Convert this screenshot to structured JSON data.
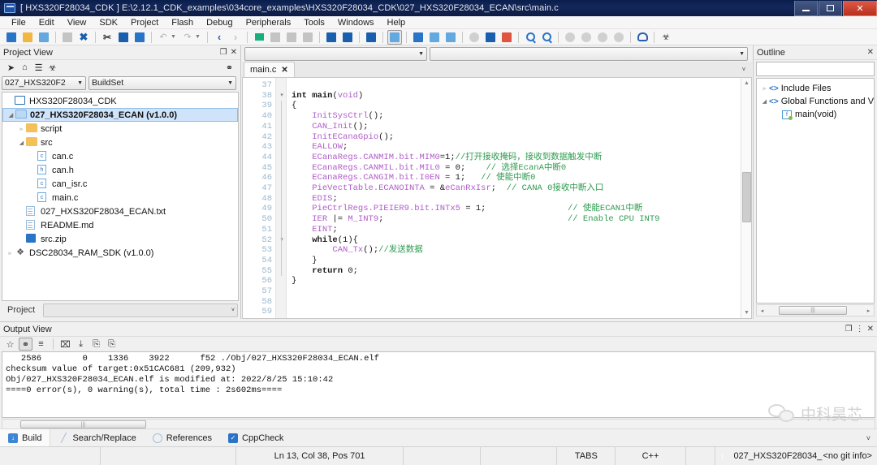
{
  "window": {
    "title": "[ HXS320F28034_CDK ] E:\\2.12.1_CDK_examples\\034core_examples\\HXS320F28034_CDK\\027_HXS320F28034_ECAN\\src\\main.c",
    "minimize_label": "–",
    "maximize_label": "□",
    "close_label": "✕"
  },
  "menu": {
    "items": [
      "File",
      "Edit",
      "View",
      "SDK",
      "Project",
      "Flash",
      "Debug",
      "Peripherals",
      "Tools",
      "Windows",
      "Help"
    ]
  },
  "toolbar": {
    "groups": [
      {
        "buttons": [
          {
            "name": "new-file-button",
            "glyph": "▤",
            "style": "blue"
          },
          {
            "name": "open-folder-button",
            "glyph": "▭",
            "style": "orange"
          },
          {
            "name": "open-file-button",
            "glyph": "◉",
            "style": "lightblue"
          }
        ]
      },
      {
        "buttons": [
          {
            "name": "save-button",
            "glyph": "■",
            "style": "gray"
          },
          {
            "name": "close-file-button",
            "glyph": "✖",
            "style": "x"
          }
        ]
      },
      {
        "buttons": [
          {
            "name": "cut-button",
            "glyph": "✂",
            "style": "scissors"
          },
          {
            "name": "copy-button",
            "glyph": "⧉",
            "style": "bluedk"
          },
          {
            "name": "paste-button",
            "glyph": "⎘",
            "style": "blue"
          }
        ]
      },
      {
        "buttons": [
          {
            "name": "undo-button",
            "glyph": "↶",
            "style": "arrow"
          },
          {
            "name": "undo-dropdown",
            "glyph": "▾",
            "style": "caret"
          },
          {
            "name": "redo-button",
            "glyph": "↷",
            "style": "arrow"
          },
          {
            "name": "redo-dropdown",
            "glyph": "▾",
            "style": "caret"
          }
        ]
      },
      {
        "buttons": [
          {
            "name": "navigate-back-button",
            "glyph": "‹",
            "style": "lt"
          },
          {
            "name": "navigate-forward-button",
            "glyph": "›",
            "style": "gt"
          }
        ]
      },
      {
        "buttons": [
          {
            "name": "build-run-button",
            "glyph": "▰",
            "style": "flag"
          },
          {
            "name": "stop-button",
            "glyph": "■",
            "style": "gray"
          },
          {
            "name": "pause-button",
            "glyph": "■",
            "style": "gray"
          },
          {
            "name": "rebuild-button",
            "glyph": "■",
            "style": "gray"
          }
        ]
      },
      {
        "buttons": [
          {
            "name": "find-button",
            "glyph": "⌕",
            "style": "bluedk"
          },
          {
            "name": "find-replace-button",
            "glyph": "⌕",
            "style": "bluedk"
          }
        ]
      },
      {
        "buttons": [
          {
            "name": "find-in-files-button",
            "glyph": "⌕",
            "style": "bluedk"
          }
        ]
      },
      {
        "buttons": [
          {
            "name": "format-code-button",
            "glyph": "A",
            "style": "boxed"
          }
        ]
      },
      {
        "buttons": [
          {
            "name": "package-button",
            "glyph": "⬢",
            "style": "blue"
          },
          {
            "name": "download-flash-button",
            "glyph": "⬇",
            "style": "lightblue"
          },
          {
            "name": "erase-flash-button",
            "glyph": "⬇",
            "style": "lightblue"
          }
        ]
      },
      {
        "buttons": [
          {
            "name": "debug-circle-button",
            "glyph": "●",
            "style": "circ"
          },
          {
            "name": "device-button",
            "glyph": "□",
            "style": "bluedk"
          },
          {
            "name": "calculator-button",
            "glyph": "▦",
            "style": "red"
          }
        ]
      },
      {
        "buttons": [
          {
            "name": "zoom-in-button",
            "glyph": "⌕",
            "style": "mag"
          },
          {
            "name": "zoom-out-button",
            "glyph": "⌕",
            "style": "mag"
          }
        ]
      },
      {
        "buttons": [
          {
            "name": "breakpoint-button",
            "glyph": "●",
            "style": "circ-dim"
          },
          {
            "name": "link-disabled-button",
            "glyph": "⚭",
            "style": "circ-dim"
          },
          {
            "name": "chain-button",
            "glyph": "⚭",
            "style": "circ-dim"
          },
          {
            "name": "unlink-button",
            "glyph": "⚭",
            "style": "circ-dim"
          }
        ]
      },
      {
        "buttons": [
          {
            "name": "support-headset-button",
            "glyph": "⌂",
            "style": "head"
          }
        ]
      },
      {
        "buttons": [
          {
            "name": "bug-report-button",
            "glyph": "☣",
            "style": "bug"
          }
        ]
      }
    ]
  },
  "project_view": {
    "title": "Project View",
    "float_label": "❐",
    "close_label": "✕",
    "tool_icons": [
      "navigate-icon",
      "home-icon",
      "collapse-icon",
      "bug-icon"
    ],
    "link_icon": "link-icon",
    "combo_project": "027_HXS320F2",
    "combo_buildset": "BuildSet",
    "tree": [
      {
        "label": "HXS320F28034_CDK",
        "indent": 0,
        "icon": "monitor-icon",
        "twisty": "",
        "selected": false
      },
      {
        "label": "027_HXS320F28034_ECAN (v1.0.0)",
        "indent": 0,
        "icon": "folder-blue-icon",
        "twisty": "◢",
        "selected": true
      },
      {
        "label": "script",
        "indent": 1,
        "icon": "folder-icon",
        "twisty": "▹",
        "selected": false
      },
      {
        "label": "src",
        "indent": 1,
        "icon": "folder-icon",
        "twisty": "◢",
        "selected": false
      },
      {
        "label": "can.c",
        "indent": 2,
        "icon": "c-file-icon",
        "twisty": "",
        "selected": false
      },
      {
        "label": "can.h",
        "indent": 2,
        "icon": "h-file-icon",
        "twisty": "",
        "selected": false
      },
      {
        "label": "can_isr.c",
        "indent": 2,
        "icon": "c-file-icon",
        "twisty": "",
        "selected": false
      },
      {
        "label": "main.c",
        "indent": 2,
        "icon": "c-file-icon",
        "twisty": "",
        "selected": false
      },
      {
        "label": "027_HXS320F28034_ECAN.txt",
        "indent": 1,
        "icon": "doc-icon",
        "twisty": "",
        "selected": false
      },
      {
        "label": "README.md",
        "indent": 1,
        "icon": "doc-icon",
        "twisty": "",
        "selected": false
      },
      {
        "label": "src.zip",
        "indent": 1,
        "icon": "zip-icon",
        "twisty": "",
        "selected": false
      },
      {
        "label": "DSC28034_RAM_SDK (v1.0.0)",
        "indent": 0,
        "icon": "sdk-icon",
        "twisty": "▹",
        "selected": false
      }
    ],
    "footer_tab": "Project",
    "footer_caret": "˅"
  },
  "editor": {
    "combo_left": "",
    "combo_right": "",
    "combo_caret": "▾",
    "tab_label": "main.c",
    "tab_close": "✕",
    "tab_list_caret": "˅",
    "first_line_number": 37,
    "lines": [
      {
        "n": 37,
        "segments": []
      },
      {
        "n": 38,
        "segments": [
          {
            "t": "int ",
            "c": "kw"
          },
          {
            "t": "main",
            "c": "kw"
          },
          {
            "t": "(",
            "c": "pl"
          },
          {
            "t": "void",
            "c": "id"
          },
          {
            "t": ")",
            "c": "pl"
          }
        ]
      },
      {
        "n": 39,
        "segments": [
          {
            "t": "{",
            "c": "pl"
          }
        ]
      },
      {
        "n": 40,
        "segments": [
          {
            "t": "    ",
            "c": "pl"
          },
          {
            "t": "InitSysCtrl",
            "c": "id"
          },
          {
            "t": "();",
            "c": "pl"
          }
        ]
      },
      {
        "n": 41,
        "segments": [
          {
            "t": "    ",
            "c": "pl"
          },
          {
            "t": "CAN_Init",
            "c": "id"
          },
          {
            "t": "();",
            "c": "pl"
          }
        ]
      },
      {
        "n": 42,
        "segments": [
          {
            "t": "    ",
            "c": "pl"
          },
          {
            "t": "InitECanaGpio",
            "c": "id"
          },
          {
            "t": "();",
            "c": "pl"
          }
        ]
      },
      {
        "n": 43,
        "segments": [
          {
            "t": "    ",
            "c": "pl"
          },
          {
            "t": "EALLOW",
            "c": "id"
          },
          {
            "t": ";",
            "c": "pl"
          }
        ]
      },
      {
        "n": 44,
        "segments": [
          {
            "t": "    ",
            "c": "pl"
          },
          {
            "t": "ECanaRegs.CANMIM.bit.MIM0",
            "c": "id"
          },
          {
            "t": "=1;",
            "c": "pl"
          },
          {
            "t": "//打开接收掩码，接收到数据触发中断",
            "c": "cm"
          }
        ]
      },
      {
        "n": 45,
        "segments": [
          {
            "t": "    ",
            "c": "pl"
          },
          {
            "t": "ECanaRegs.CANMIL.bit.MIL0",
            "c": "id"
          },
          {
            "t": " = 0;    ",
            "c": "pl"
          },
          {
            "t": "// 选择EcanA中断0",
            "c": "cm"
          }
        ]
      },
      {
        "n": 46,
        "segments": [
          {
            "t": "    ",
            "c": "pl"
          },
          {
            "t": "ECanaRegs.CANGIM.bit.I0EN",
            "c": "id"
          },
          {
            "t": " = 1;   ",
            "c": "pl"
          },
          {
            "t": "// 使能中断0",
            "c": "cm"
          }
        ]
      },
      {
        "n": 47,
        "segments": [
          {
            "t": "    ",
            "c": "pl"
          },
          {
            "t": "PieVectTable.ECANOINTA",
            "c": "id"
          },
          {
            "t": " = &",
            "c": "pl"
          },
          {
            "t": "eCanRxIsr",
            "c": "id"
          },
          {
            "t": ";  ",
            "c": "pl"
          },
          {
            "t": "// CANA 0接收中断入口",
            "c": "cm"
          }
        ]
      },
      {
        "n": 48,
        "segments": [
          {
            "t": "    ",
            "c": "pl"
          },
          {
            "t": "EDIS",
            "c": "id"
          },
          {
            "t": ";",
            "c": "pl"
          }
        ]
      },
      {
        "n": 49,
        "segments": [
          {
            "t": "    ",
            "c": "pl"
          },
          {
            "t": "PieCtrlRegs.PIEIER9.bit.INTx5",
            "c": "id"
          },
          {
            "t": " = 1;",
            "c": "pl"
          }
        ],
        "right_comment": "// 使能ECAN1中断"
      },
      {
        "n": 50,
        "segments": [
          {
            "t": "    ",
            "c": "pl"
          },
          {
            "t": "IER",
            "c": "id"
          },
          {
            "t": " |= ",
            "c": "pl"
          },
          {
            "t": "M_INT9",
            "c": "id"
          },
          {
            "t": ";",
            "c": "pl"
          }
        ],
        "right_comment": "// Enable CPU INT9"
      },
      {
        "n": 51,
        "segments": [
          {
            "t": "    ",
            "c": "pl"
          },
          {
            "t": "EINT",
            "c": "id"
          },
          {
            "t": ";",
            "c": "pl"
          }
        ]
      },
      {
        "n": 52,
        "segments": [
          {
            "t": "    ",
            "c": "pl"
          },
          {
            "t": "while",
            "c": "kw"
          },
          {
            "t": "(1){",
            "c": "pl"
          }
        ]
      },
      {
        "n": 53,
        "segments": [
          {
            "t": "        ",
            "c": "pl"
          },
          {
            "t": "CAN_Tx",
            "c": "id"
          },
          {
            "t": "();",
            "c": "pl"
          },
          {
            "t": "//发送数据",
            "c": "cm"
          }
        ]
      },
      {
        "n": 54,
        "segments": [
          {
            "t": "    }",
            "c": "pl"
          }
        ]
      },
      {
        "n": 55,
        "segments": [
          {
            "t": "    ",
            "c": "pl"
          },
          {
            "t": "return",
            "c": "kw"
          },
          {
            "t": " 0;",
            "c": "pl"
          }
        ]
      },
      {
        "n": 56,
        "segments": [
          {
            "t": "}",
            "c": "pl"
          }
        ]
      },
      {
        "n": 57,
        "segments": []
      },
      {
        "n": 58,
        "segments": []
      },
      {
        "n": 59,
        "segments": []
      }
    ]
  },
  "outline": {
    "title": "Outline",
    "close_label": "✕",
    "search_value": "",
    "items": [
      {
        "label": "Include Files",
        "indent": 0,
        "twisty": "▹",
        "icon": "angle-brackets-icon"
      },
      {
        "label": "Global Functions and V",
        "indent": 0,
        "twisty": "◢",
        "icon": "angle-brackets-icon"
      },
      {
        "label": "main(void)",
        "indent": 1,
        "twisty": "",
        "icon": "function-icon"
      }
    ],
    "scroll_left": "◂",
    "scroll_right": "▸"
  },
  "output_view": {
    "title": "Output View",
    "float_label": "❐",
    "menu_label": "⋮",
    "close_label": "✕",
    "tool_icons": [
      {
        "name": "favorite-icon",
        "glyph": "☆",
        "boxed": false
      },
      {
        "name": "link-icon",
        "glyph": "⚭",
        "boxed": true
      },
      {
        "name": "wrap-lines-icon",
        "glyph": "≡",
        "boxed": false
      },
      {
        "name": "clear-output-icon",
        "glyph": "⌧",
        "boxed": false
      },
      {
        "name": "save-output-icon",
        "glyph": "⤓",
        "boxed": false
      },
      {
        "name": "copy-output-icon",
        "glyph": "⎘",
        "boxed": false
      },
      {
        "name": "paste-output-icon",
        "glyph": "⎘",
        "boxed": false
      }
    ],
    "text": "   2586        0    1336    3922      f52 ./Obj/027_HXS320F28034_ECAN.elf\nchecksum value of target:0x51CAC681 (209,932)\nObj/027_HXS320F28034_ECAN.elf is modified at: 2022/8/25 15:10:42\n====0 error(s), 0 warning(s), total time : 2s602ms===="
  },
  "bottom_tabs": [
    {
      "label": "Build",
      "icon": "build-icon",
      "active": true
    },
    {
      "label": "Search/Replace",
      "icon": "pencil-icon",
      "active": false
    },
    {
      "label": "References",
      "icon": "circle-icon",
      "active": false
    },
    {
      "label": "CppCheck",
      "icon": "checkbox-icon",
      "active": false
    }
  ],
  "bottom_tabs_caret": "˅",
  "status_bar": {
    "cell1": "",
    "cell2": "",
    "cursor": "Ln 13, Col 38, Pos 701",
    "cell4": "",
    "cell5": "",
    "tabs_mode": "TABS",
    "language": "C++",
    "cell8": "",
    "project": "027_HXS320F28034_",
    "git": "<no git info>"
  },
  "watermark": {
    "text": "中科昊芯",
    "icon": "wechat-icon"
  },
  "colors": {
    "title_bar": "#13275c",
    "accent": "#3d86d4",
    "selection": "#cfe4fb",
    "comment": "#2e9b4f",
    "identifier": "#b05cc8",
    "close_button": "#c0392b"
  }
}
